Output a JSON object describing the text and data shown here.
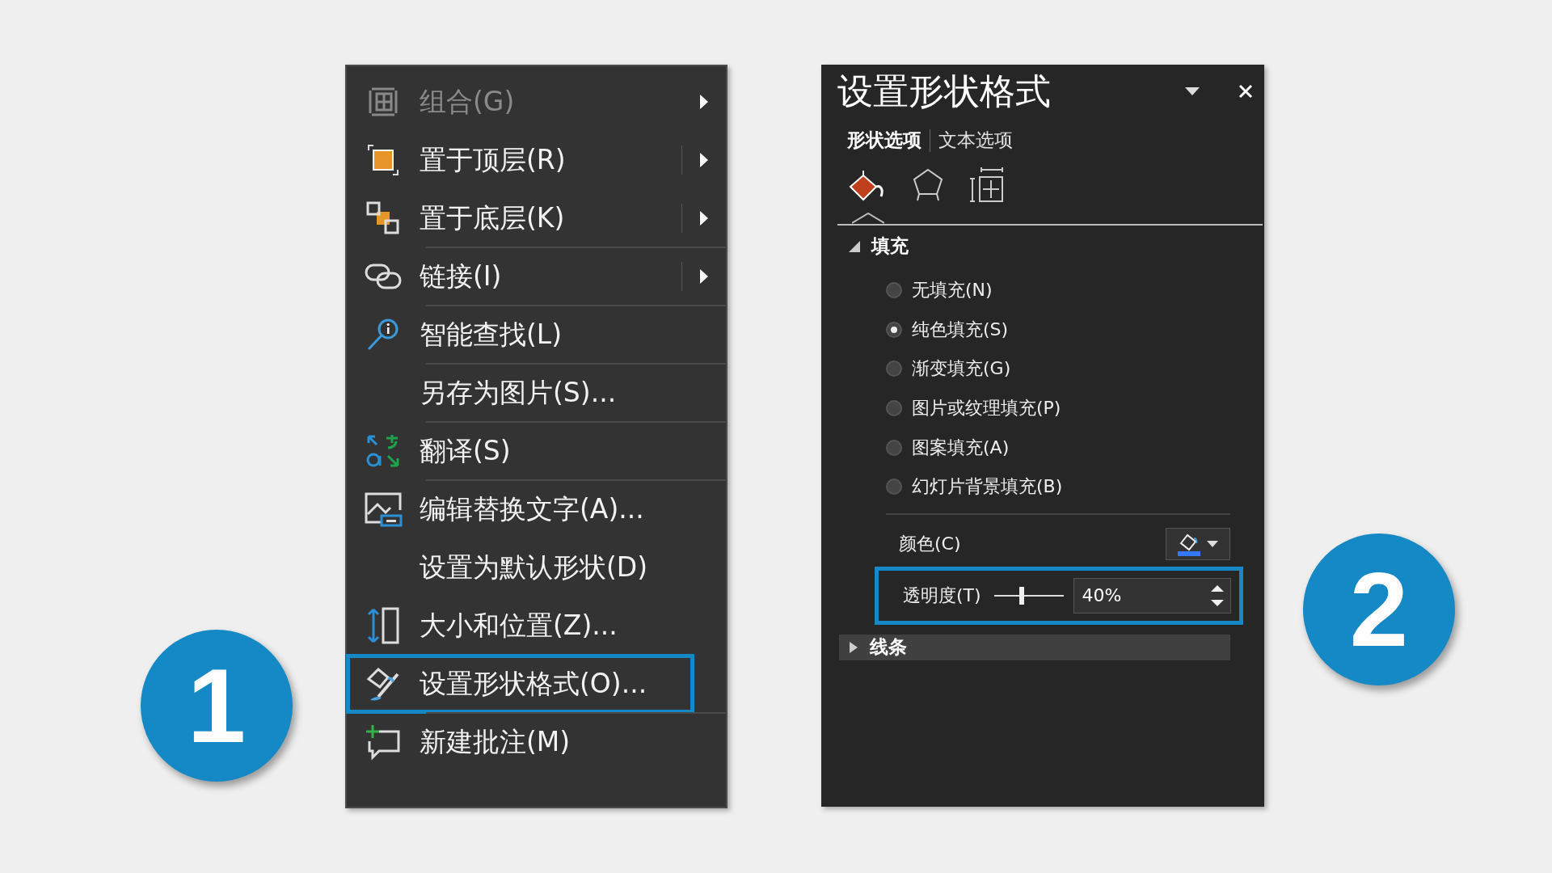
{
  "menu": {
    "items": [
      {
        "label": "组合(G)",
        "disabled": true,
        "submenu": true,
        "separator_after": false,
        "highlighted": false
      },
      {
        "label": "置于顶层(R)",
        "disabled": false,
        "submenu": true,
        "separator_after": false,
        "highlighted": false
      },
      {
        "label": "置于底层(K)",
        "disabled": false,
        "submenu": true,
        "separator_after": true,
        "highlighted": false
      },
      {
        "label": "链接(I)",
        "disabled": false,
        "submenu": true,
        "separator_after": true,
        "highlighted": false
      },
      {
        "label": "智能查找(L)",
        "disabled": false,
        "submenu": false,
        "separator_after": true,
        "highlighted": false
      },
      {
        "label": "另存为图片(S)...",
        "disabled": false,
        "submenu": false,
        "separator_after": true,
        "highlighted": false
      },
      {
        "label": "翻译(S)",
        "disabled": false,
        "submenu": false,
        "separator_after": true,
        "highlighted": false
      },
      {
        "label": "编辑替换文字(A)...",
        "disabled": false,
        "submenu": false,
        "separator_after": false,
        "highlighted": false
      },
      {
        "label": "设置为默认形状(D)",
        "disabled": false,
        "submenu": false,
        "separator_after": false,
        "highlighted": false
      },
      {
        "label": "大小和位置(Z)...",
        "disabled": false,
        "submenu": false,
        "separator_after": false,
        "highlighted": false
      },
      {
        "label": "设置形状格式(O)...",
        "disabled": false,
        "submenu": false,
        "separator_after": true,
        "highlighted": true
      },
      {
        "label": "新建批注(M)",
        "disabled": false,
        "submenu": false,
        "separator_after": false,
        "highlighted": false
      }
    ]
  },
  "panel": {
    "title": "设置形状格式",
    "tabs": [
      {
        "label": "形状选项",
        "selected": true
      },
      {
        "label": "文本选项",
        "selected": false
      }
    ],
    "icon_tabs": [
      {
        "selected": true
      },
      {
        "selected": false
      },
      {
        "selected": false
      }
    ],
    "fill": {
      "label": "填充",
      "expanded": true,
      "options": [
        {
          "label": "无填充(N)",
          "selected": false
        },
        {
          "label": "纯色填充(S)",
          "selected": true
        },
        {
          "label": "渐变填充(G)",
          "selected": false
        },
        {
          "label": "图片或纹理填充(P)",
          "selected": false
        },
        {
          "label": "图案填充(A)",
          "selected": false
        },
        {
          "label": "幻灯片背景填充(B)",
          "selected": false
        }
      ],
      "color": {
        "label": "颜色(C)",
        "color": "#3478f6"
      },
      "transparency": {
        "label": "透明度(T)",
        "level": 0.4,
        "value": "40%",
        "highlighted": true
      }
    },
    "line": {
      "label": "线条",
      "expanded": false
    }
  },
  "badges": [
    {
      "number": "1"
    },
    {
      "number": "2"
    }
  ]
}
